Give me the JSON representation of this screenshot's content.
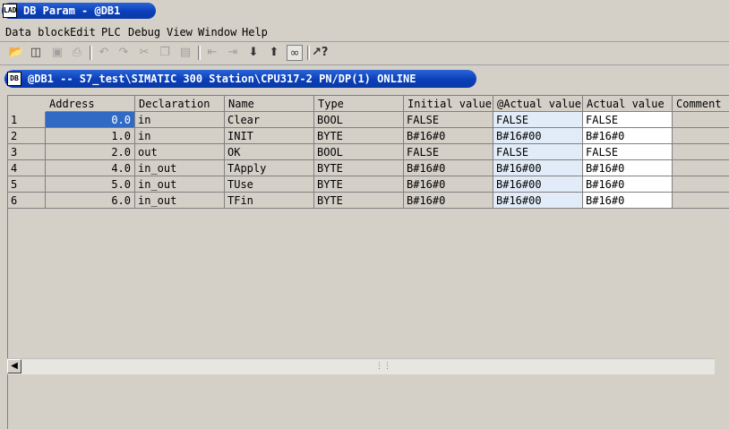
{
  "app": {
    "title": "DB Param - @DB1",
    "icon_label": "LAD"
  },
  "menu": [
    "Data block",
    "Edit",
    "PLC",
    "Debug",
    "View",
    "Window",
    "Help"
  ],
  "toolbar": {
    "icons": [
      "open-folder-icon",
      "network-access-icon",
      "save-icon",
      "print-icon",
      "undo-icon",
      "redo-icon",
      "cut-icon",
      "copy-icon",
      "paste-icon",
      "previous-icon",
      "next-icon",
      "download-icon",
      "upload-icon",
      "monitor-glasses-icon",
      "help-pointer-icon"
    ]
  },
  "child": {
    "title": "@DB1 -- S7_test\\SIMATIC 300 Station\\CPU317-2 PN/DP(1)  ONLINE",
    "icon_label": "DB"
  },
  "table": {
    "columns": [
      "Address",
      "Declaration",
      "Name",
      "Type",
      "Initial value",
      "@Actual value",
      "Actual value",
      "Comment"
    ],
    "rows": [
      {
        "num": "1",
        "address": "0.0",
        "declaration": "in",
        "name": "Clear",
        "type": "BOOL",
        "initial": "FALSE",
        "at_actual": "FALSE",
        "actual": "FALSE",
        "comment": ""
      },
      {
        "num": "2",
        "address": "1.0",
        "declaration": "in",
        "name": "INIT",
        "type": "BYTE",
        "initial": "B#16#0",
        "at_actual": "B#16#00",
        "actual": "B#16#0",
        "comment": ""
      },
      {
        "num": "3",
        "address": "2.0",
        "declaration": "out",
        "name": "OK",
        "type": "BOOL",
        "initial": "FALSE",
        "at_actual": "FALSE",
        "actual": "FALSE",
        "comment": ""
      },
      {
        "num": "4",
        "address": "4.0",
        "declaration": "in_out",
        "name": "TApply",
        "type": "BYTE",
        "initial": "B#16#0",
        "at_actual": "B#16#00",
        "actual": "B#16#0",
        "comment": ""
      },
      {
        "num": "5",
        "address": "5.0",
        "declaration": "in_out",
        "name": "TUse",
        "type": "BYTE",
        "initial": "B#16#0",
        "at_actual": "B#16#00",
        "actual": "B#16#0",
        "comment": ""
      },
      {
        "num": "6",
        "address": "6.0",
        "declaration": "in_out",
        "name": "TFin",
        "type": "BYTE",
        "initial": "B#16#0",
        "at_actual": "B#16#00",
        "actual": "B#16#0",
        "comment": ""
      }
    ]
  }
}
